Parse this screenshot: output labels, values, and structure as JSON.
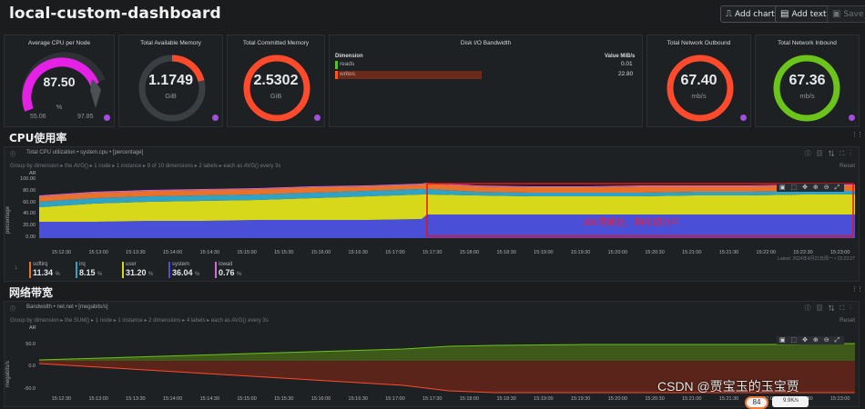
{
  "header": {
    "title": "local-custom-dashboard",
    "add_chart": "Add chart",
    "add_text": "Add text",
    "save": "Save"
  },
  "cards": [
    {
      "title": "Average CPU per Node",
      "value": "87.50",
      "unit": "%",
      "min": "55.06",
      "max": "97.85",
      "color": "#e621e6",
      "percent": 0.75
    },
    {
      "title": "Total Available Memory",
      "value": "1.1749",
      "unit": "GiB",
      "color": "#ff4a2b",
      "percent": 0.22
    },
    {
      "title": "Total Committed Memory",
      "value": "2.5302",
      "unit": "GiB",
      "color": "#ff4a2b",
      "percent": 1.0
    },
    {
      "title": "Disk I/O Bandwidth",
      "dimension_label": "Dimension",
      "value_label": "Value",
      "unit": "MiB/s",
      "rows": [
        {
          "name": "reads",
          "value": "0.01",
          "color": "#5bbf2b"
        },
        {
          "name": "writes",
          "value": "22.80",
          "color": "#ff5722"
        }
      ]
    },
    {
      "title": "Total Network Outbound",
      "value": "67.40",
      "unit": "mb/s",
      "color": "#ff4a2b",
      "percent": 1.0
    },
    {
      "title": "Total Network Inbound",
      "value": "67.36",
      "unit": "mb/s",
      "color": "#6cc31a",
      "percent": 1.0
    }
  ],
  "cpu_section": {
    "heading": "CPU使用率"
  },
  "cpu_panel": {
    "title": "Total CPU utilization • system.cpu • [percentage]",
    "controls": "Group by dimension  ▸ the AVG()  ▸ 1 node  ▸ 1 instance  ▸ 9 of 10 dimensions  ▸ 2 labels  ▸ each as AVG() every 3s",
    "reset": "Reset",
    "ylabel": "percentage",
    "ar": "AR",
    "yticks": [
      "100.00",
      "80.00",
      "60.00",
      "40.00",
      "20.00",
      "0.00"
    ],
    "xticks": [
      "15:12:30",
      "15:13:00",
      "15:13:30",
      "15:14:00",
      "15:14:30",
      "15:15:00",
      "15:15:30",
      "15:16:00",
      "15:16:30",
      "15:17:00",
      "15:17:30",
      "15:18:00",
      "15:18:30",
      "15:19:00",
      "15:19:30",
      "15:20:00",
      "15:20:30",
      "15:21:00",
      "15:21:30",
      "15:22:00",
      "15:22:30",
      "15:23:00"
    ],
    "annotation": "400路通话，持续进行中",
    "latest": "Latest: 2024年4月21日周一 • 15:23:27",
    "legend": [
      {
        "name": "softirq",
        "value": "11.34",
        "unit": "%",
        "color": "#e8722b"
      },
      {
        "name": "irq",
        "value": "8.15",
        "unit": "%",
        "color": "#2fa3c6"
      },
      {
        "name": "user",
        "value": "31.20",
        "unit": "%",
        "color": "#d8d81a"
      },
      {
        "name": "system",
        "value": "36.04",
        "unit": "%",
        "color": "#4a4fd8"
      },
      {
        "name": "iowait",
        "value": "0.76",
        "unit": "%",
        "color": "#d06be0"
      }
    ]
  },
  "net_section": {
    "heading": "网络带宽"
  },
  "net_panel": {
    "title": "Bandwidth • net.net • [megabits/s]",
    "controls": "Group by dimension  ▸ the SUM()  ▸ 1 node  ▸ 1 instance  ▸ 2 dimensions  ▸ 4 labels  ▸ each as AVG() every 3s",
    "reset": "Reset",
    "ylabel": "megabits/s",
    "ar": "AR",
    "yticks": [
      "50.0",
      "0.0",
      "-50.0"
    ],
    "xticks": [
      "15:12:30",
      "15:13:00",
      "15:13:30",
      "15:14:00",
      "15:14:30",
      "15:15:00",
      "15:15:30",
      "15:16:00",
      "15:16:30",
      "15:17:00",
      "15:17:30",
      "15:18:00",
      "15:18:30",
      "15:19:00",
      "15:19:30",
      "15:20:00",
      "15:20:30",
      "15:21:00",
      "15:21:30",
      "15:22:00",
      "15:22:30",
      "15:23:00"
    ]
  },
  "watermark": "CSDN @贾宝玉的玉宝贾",
  "overlay": {
    "speed": "9.9K/s",
    "cpu": "84"
  },
  "colors": {
    "bg": "#1a1c1e",
    "card": "#1e2124",
    "red": "#ff4a2b",
    "green": "#6cc31a",
    "magenta": "#e621e6"
  }
}
